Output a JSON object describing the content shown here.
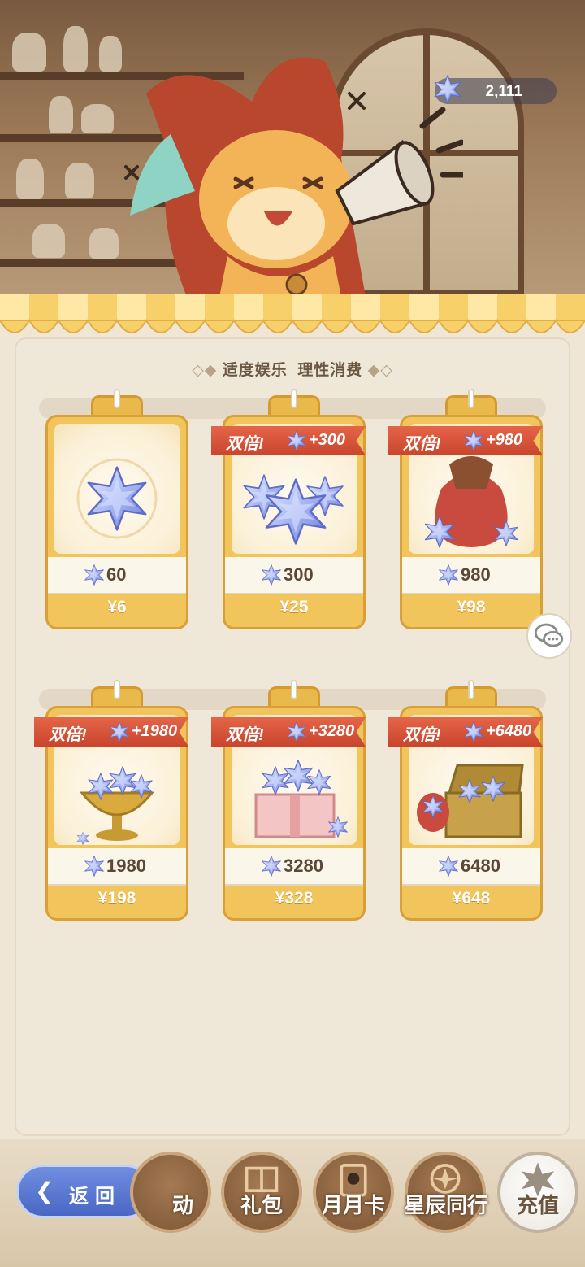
{
  "header": {
    "currency_amount": "2,111"
  },
  "slogan": {
    "left": "适度娱乐",
    "right": "理性消费"
  },
  "cards": [
    {
      "amount": "60",
      "price": "¥6",
      "double": false,
      "ribbon_label": "",
      "bonus": "",
      "art": "single-star"
    },
    {
      "amount": "300",
      "price": "¥25",
      "double": true,
      "ribbon_label": "双倍!",
      "bonus": "+300",
      "art": "star-cluster"
    },
    {
      "amount": "980",
      "price": "¥98",
      "double": true,
      "ribbon_label": "双倍!",
      "bonus": "+980",
      "art": "star-bag"
    },
    {
      "amount": "1980",
      "price": "¥198",
      "double": true,
      "ribbon_label": "双倍!",
      "bonus": "+1980",
      "art": "star-chalice"
    },
    {
      "amount": "3280",
      "price": "¥328",
      "double": true,
      "ribbon_label": "双倍!",
      "bonus": "+3280",
      "art": "star-giftbox"
    },
    {
      "amount": "6480",
      "price": "¥648",
      "double": true,
      "ribbon_label": "双倍!",
      "bonus": "+6480",
      "art": "star-treasure-chest"
    }
  ],
  "nav": {
    "back_label": "返回",
    "tabs": [
      {
        "label": "动",
        "active": false
      },
      {
        "label": "礼包",
        "active": false
      },
      {
        "label": "月月卡",
        "active": false
      },
      {
        "label": "星辰同行",
        "active": false
      },
      {
        "label": "充值",
        "active": true
      }
    ]
  },
  "colors": {
    "accent_gold": "#f1c55b",
    "ribbon_red": "#d4503a",
    "back_blue": "#5a78d4"
  },
  "icons": {
    "currency": "star-crystal-icon",
    "chat": "chat-bubbles-icon"
  }
}
